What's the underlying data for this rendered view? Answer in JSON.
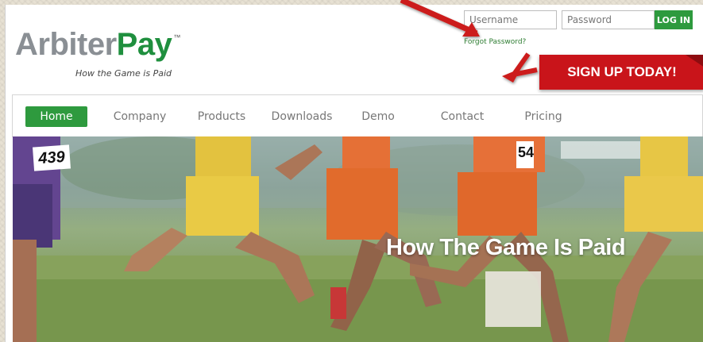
{
  "brand": {
    "name_part1": "Arbiter",
    "name_part2": "Pay",
    "trademark": "™",
    "tagline": "How the Game is Paid"
  },
  "login": {
    "username_placeholder": "Username",
    "password_placeholder": "Password",
    "button_label": "LOG IN",
    "forgot_label": "Forgot Password?"
  },
  "signup": {
    "label": "SIGN UP TODAY!"
  },
  "nav": {
    "items": [
      {
        "label": "Home",
        "active": true
      },
      {
        "label": "Company",
        "active": false
      },
      {
        "label": "Products",
        "active": false
      },
      {
        "label": "Downloads",
        "active": false
      },
      {
        "label": "Demo",
        "active": false
      },
      {
        "label": "Contact",
        "active": false
      },
      {
        "label": "Pricing",
        "active": false
      }
    ]
  },
  "hero": {
    "title": "How The Game Is Paid",
    "bib_number": "439",
    "bib_number_2": "54"
  },
  "colors": {
    "brand_green": "#2e9a3e",
    "signup_red": "#c9141a",
    "logo_grey": "#8a8f94"
  }
}
